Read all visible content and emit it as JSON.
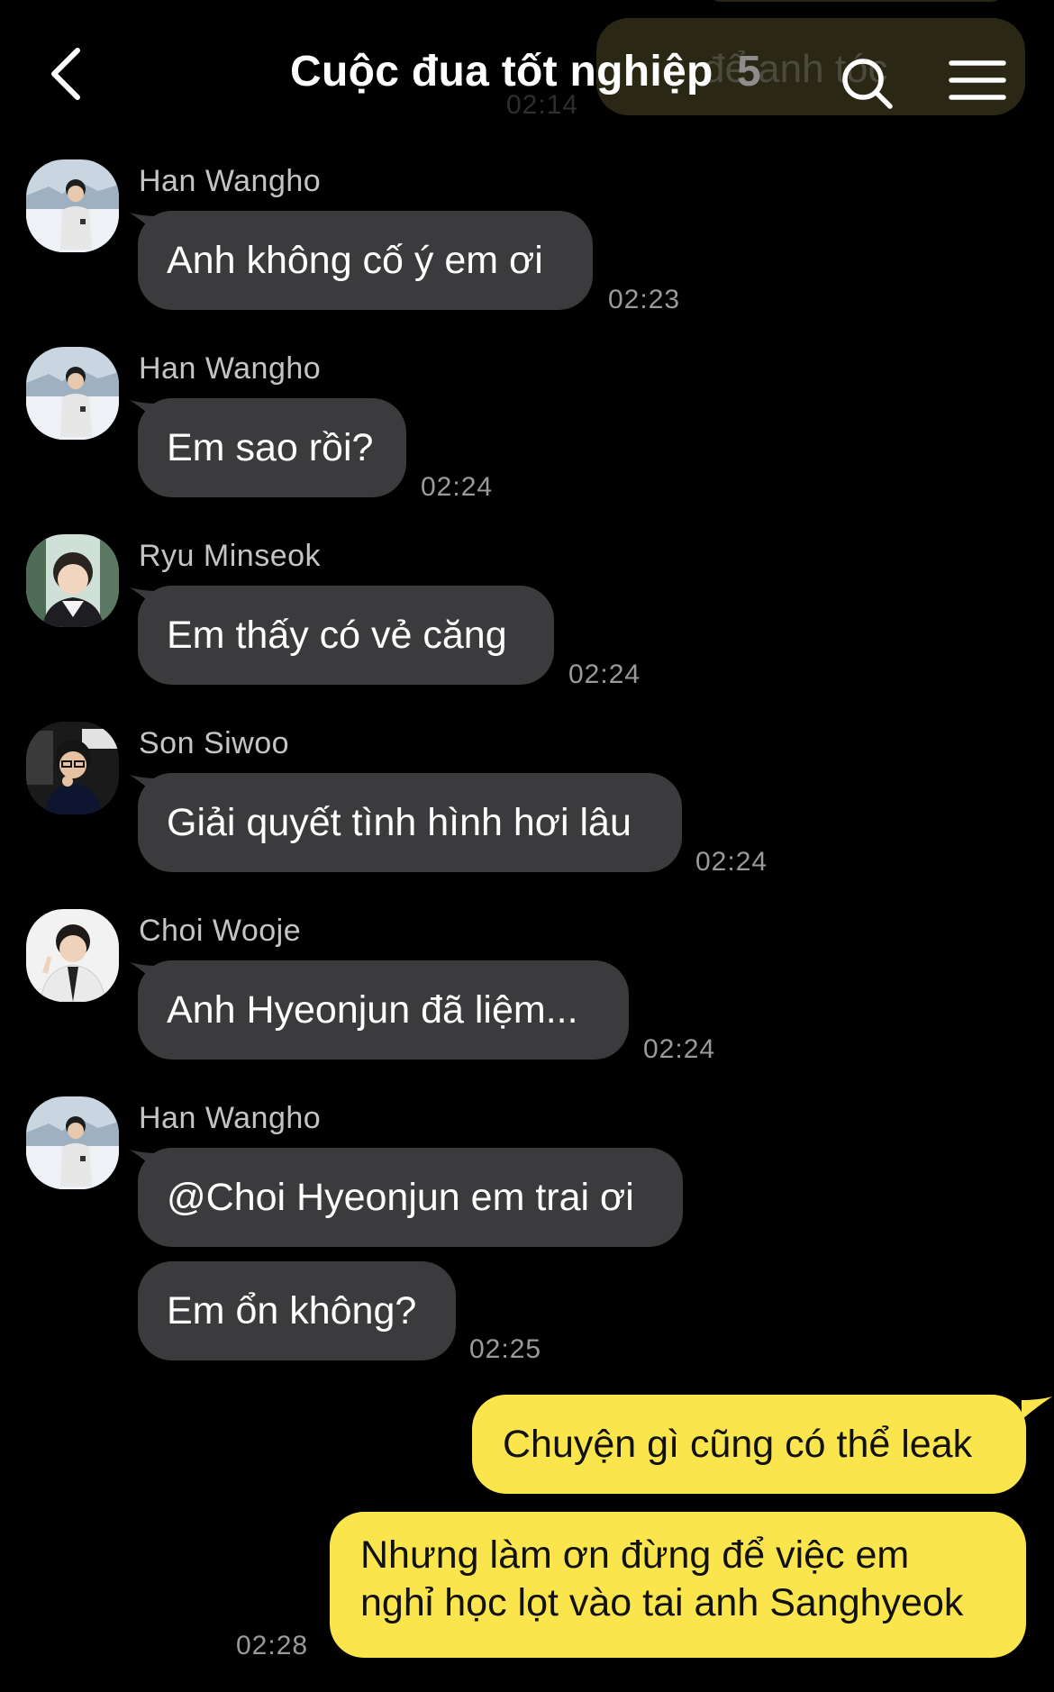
{
  "header": {
    "title": "Cuộc đua tốt nghiệp",
    "member_count": "5",
    "background_snippet_text": "để anh tóc",
    "background_snippet_time": "02:14"
  },
  "messages": [
    {
      "sender": "Han Wangho",
      "text": "Anh không cố ý em ơi",
      "time": "02:23"
    },
    {
      "sender": "Han Wangho",
      "text": "Em sao rồi?",
      "time": "02:24"
    },
    {
      "sender": "Ryu Minseok",
      "text": "Em thấy có vẻ căng",
      "time": "02:24"
    },
    {
      "sender": "Son Siwoo",
      "text": "Giải quyết tình hình hơi lâu",
      "time": "02:24"
    },
    {
      "sender": "Choi Wooje",
      "text": "Anh Hyeonjun đã liệm...",
      "time": "02:24"
    },
    {
      "sender": "Han Wangho",
      "text_1": "@Choi Hyeonjun em trai ơi",
      "text_2": "Em ổn không?",
      "time": "02:25"
    }
  ],
  "outgoing": {
    "message_1": "Chuyện gì cũng có thể leak",
    "message_2_line_1": "Nhưng làm ơn đừng để việc em",
    "message_2_line_2": "nghỉ học lọt vào tai anh Sanghyeok",
    "time": "02:28"
  },
  "icons": {
    "back": "chevron-left-icon",
    "search": "search-icon",
    "menu": "hamburger-menu-icon"
  },
  "colors": {
    "background": "#000000",
    "incoming_bubble": "#3b3b3d",
    "outgoing_bubble": "#fbe54d",
    "timestamp": "#9a9a9a",
    "sender_name": "#c4c4c4"
  }
}
